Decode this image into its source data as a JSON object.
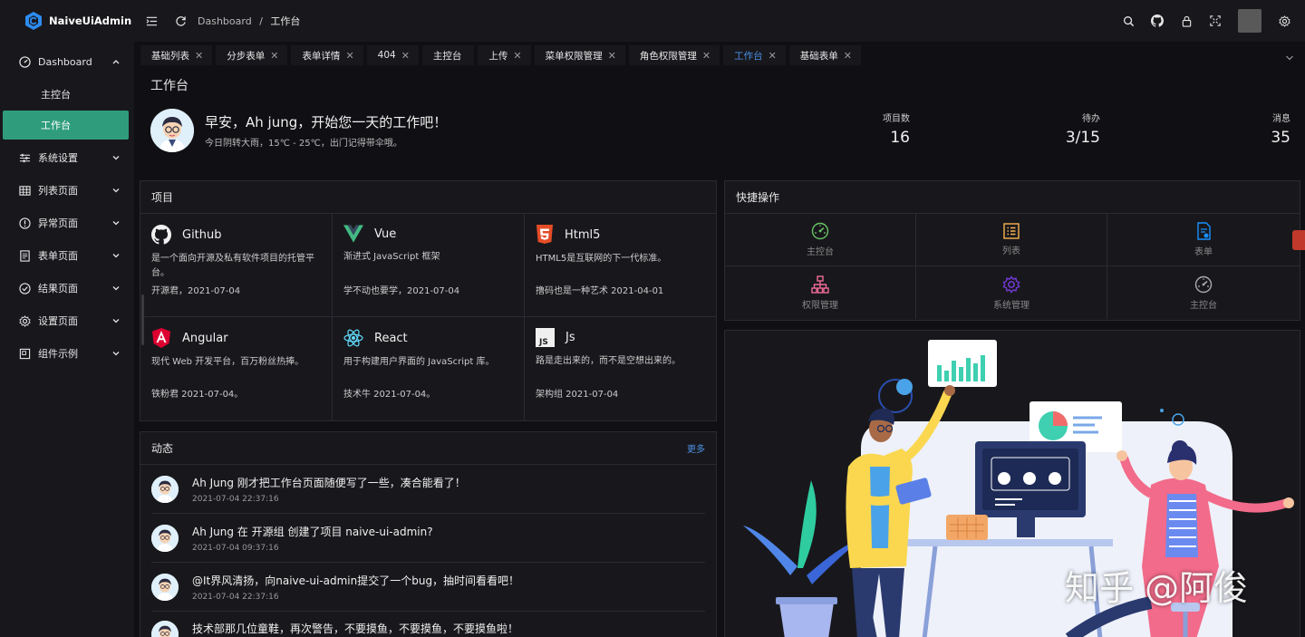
{
  "app": {
    "title": "NaiveUiAdmin"
  },
  "sidebar": {
    "items": [
      {
        "label": "Dashboard",
        "icon": "dashboard-icon",
        "expanded": true,
        "children": [
          {
            "label": "主控台"
          },
          {
            "label": "工作台",
            "active": true
          }
        ]
      },
      {
        "label": "系统设置",
        "icon": "sliders-icon"
      },
      {
        "label": "列表页面",
        "icon": "table-icon"
      },
      {
        "label": "异常页面",
        "icon": "alert-circle-icon"
      },
      {
        "label": "表单页面",
        "icon": "form-icon"
      },
      {
        "label": "结果页面",
        "icon": "check-circle-icon"
      },
      {
        "label": "设置页面",
        "icon": "gear-icon"
      },
      {
        "label": "组件示例",
        "icon": "component-icon"
      }
    ]
  },
  "header": {
    "breadcrumb": {
      "root": "Dashboard",
      "separator": "/",
      "current": "工作台"
    },
    "icons": [
      "search-icon",
      "github-icon",
      "lock-icon",
      "fullscreen-icon",
      "avatar",
      "gear-icon"
    ]
  },
  "tabs": [
    {
      "label": "基础列表"
    },
    {
      "label": "分步表单"
    },
    {
      "label": "表单详情"
    },
    {
      "label": "404"
    },
    {
      "label": "主控台",
      "closable": false
    },
    {
      "label": "上传"
    },
    {
      "label": "菜单权限管理"
    },
    {
      "label": "角色权限管理"
    },
    {
      "label": "工作台",
      "active": true
    },
    {
      "label": "基础表单"
    }
  ],
  "page": {
    "title": "工作台",
    "greeting": "早安，Ah jung，开始您一天的工作吧！",
    "weather": "今日阴转大雨，15℃ - 25℃，出门记得带伞哦。",
    "stats": [
      {
        "label": "项目数",
        "value": "16"
      },
      {
        "label": "待办",
        "value": "3/15"
      },
      {
        "label": "消息",
        "value": "35"
      }
    ]
  },
  "projects": {
    "title": "项目",
    "items": [
      {
        "name": "Github",
        "icon": "github-icon",
        "desc": "是一个面向开源及私有软件项目的托管平台。",
        "footer": "开源君，2021-07-04"
      },
      {
        "name": "Vue",
        "icon": "vue-icon",
        "desc": "渐进式 JavaScript 框架",
        "footer": "学不动也要学，2021-07-04"
      },
      {
        "name": "Html5",
        "icon": "html5-icon",
        "desc": "HTML5是互联网的下一代标准。",
        "footer": "撸码也是一种艺术 2021-04-01"
      },
      {
        "name": "Angular",
        "icon": "angular-icon",
        "desc": "现代 Web 开发平台，百万粉丝热捧。",
        "footer": "铁粉君 2021-07-04。"
      },
      {
        "name": "React",
        "icon": "react-icon",
        "desc": "用于构建用户界面的 JavaScript 库。",
        "footer": "技术牛 2021-07-04。"
      },
      {
        "name": "Js",
        "icon": "js-icon",
        "desc": "路是走出来的，而不是空想出来的。",
        "footer": "架构组 2021-07-04"
      }
    ]
  },
  "activity": {
    "title": "动态",
    "more": "更多",
    "items": [
      {
        "text": "Ah Jung 刚才把工作台页面随便写了一些，凑合能看了！",
        "time": "2021-07-04 22:37:16"
      },
      {
        "text": "Ah Jung 在 开源组 创建了项目 naive-ui-admin?",
        "time": "2021-07-04 09:37:16"
      },
      {
        "text": "@It界风清扬，向naive-ui-admin提交了一个bug，抽时间看看吧！",
        "time": "2021-07-04 22:37:16"
      },
      {
        "text": "技术部那几位童鞋，再次警告，不要摸鱼，不要摸鱼，不要摸鱼啦！",
        "time": ""
      }
    ]
  },
  "quick": {
    "title": "快捷操作",
    "items": [
      {
        "label": "主控台",
        "icon": "dashboard-icon",
        "color": "#69c265"
      },
      {
        "label": "列表",
        "icon": "list-icon",
        "color": "#fab251"
      },
      {
        "label": "表单",
        "icon": "form-icon",
        "color": "#1890ff"
      },
      {
        "label": "权限管理",
        "icon": "sitemap-icon",
        "color": "#f06b96"
      },
      {
        "label": "系统管理",
        "icon": "gear-icon",
        "color": "#7238d1"
      },
      {
        "label": "主控台",
        "icon": "dashboard-icon",
        "color": "#aaaaaa"
      }
    ]
  },
  "watermark": "知乎 @阿俊"
}
